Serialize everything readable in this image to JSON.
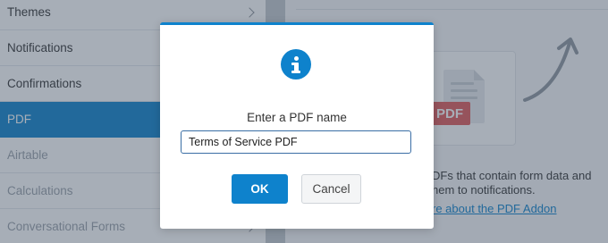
{
  "sidebar": {
    "items": [
      {
        "label": "Themes",
        "state": "normal",
        "has_chevron": true
      },
      {
        "label": "Notifications",
        "state": "normal",
        "has_chevron": false
      },
      {
        "label": "Confirmations",
        "state": "normal",
        "has_chevron": false
      },
      {
        "label": "PDF",
        "state": "active",
        "has_chevron": false
      },
      {
        "label": "Airtable",
        "state": "muted",
        "has_chevron": false
      },
      {
        "label": "Calculations",
        "state": "muted",
        "has_chevron": false
      },
      {
        "label": "Conversational Forms",
        "state": "muted",
        "has_chevron": true
      }
    ]
  },
  "main": {
    "card_badge": "PDF",
    "description_line1": "DFs that contain form data and",
    "description_line2": "hem to notifications.",
    "link_text": "re about the PDF Addon"
  },
  "modal": {
    "icon": "info-icon",
    "prompt": "Enter a PDF name",
    "input_value": "Terms of Service PDF",
    "ok_label": "OK",
    "cancel_label": "Cancel"
  },
  "colors": {
    "accent": "#0e82cc",
    "overlay": "rgba(60,76,96,0.45)",
    "pdf_badge": "#e05a5a"
  }
}
